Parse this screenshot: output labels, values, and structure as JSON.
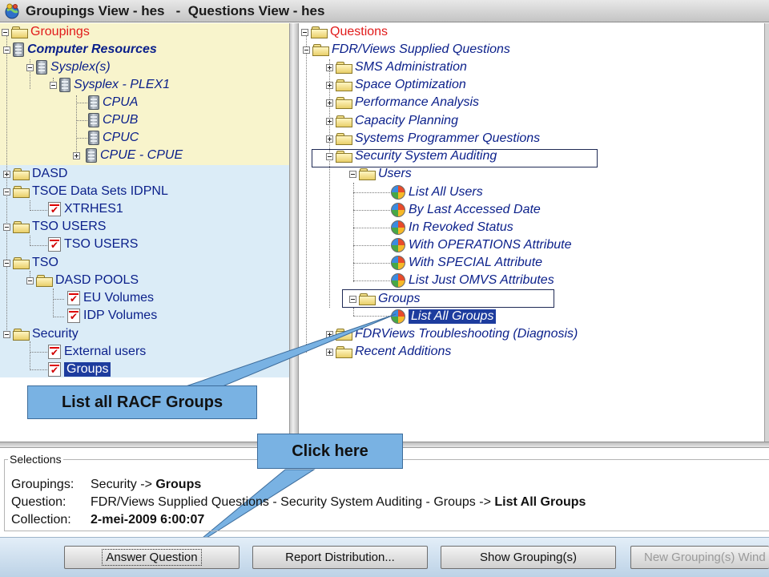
{
  "window": {
    "title": "Groupings View - hes   -  Questions View - hes"
  },
  "groupings_tree": {
    "root": "Groupings",
    "computer_resources": "Computer Resources",
    "sysplexes": "Sysplex(s)",
    "sysplex_plex1": "Sysplex - PLEX1",
    "cpus": [
      "CPUA",
      "CPUB",
      "CPUC",
      "CPUE - CPUE"
    ],
    "dasd": "DASD",
    "tsoe_data_sets": "TSOE Data Sets IDPNL",
    "xtrhes1": "XTRHES1",
    "tso_users_group": "TSO USERS",
    "tso_users_item": "TSO USERS",
    "tso": "TSO",
    "dasd_pools": "DASD POOLS",
    "eu_volumes": "EU Volumes",
    "idp_volumes": "IDP Volumes",
    "security": "Security",
    "external_users": "External users",
    "groups": "Groups"
  },
  "questions_tree": {
    "root": "Questions",
    "supplied": "FDR/Views Supplied Questions",
    "categories": [
      "SMS Administration",
      "Space Optimization",
      "Performance Analysis",
      "Capacity Planning",
      "Systems Programmer Questions"
    ],
    "security_auditing": "Security System Auditing",
    "users": "Users",
    "user_questions": [
      "List All Users",
      "By Last Accessed Date",
      "In Revoked Status",
      "With OPERATIONS Attribute",
      "With SPECIAL Attribute",
      "List Just OMVS Attributes"
    ],
    "groups": "Groups",
    "list_all_groups": "List All Groups",
    "troubleshooting": "FDRViews Troubleshooting (Diagnosis)",
    "recent_additions": "Recent Additions"
  },
  "callouts": {
    "list_all_racf_groups": "List all RACF Groups",
    "click_here": "Click here"
  },
  "selections": {
    "legend": "Selections",
    "groupings_label": "Groupings:",
    "groupings_path": "Security -> ",
    "groupings_value": "Groups",
    "question_label": "Question:",
    "question_path": "FDR/Views Supplied Questions - Security System Auditing - Groups -> ",
    "question_value": "List All Groups",
    "collection_label": "Collection:",
    "collection_value": "2-mei-2009 6:00:07"
  },
  "buttons": {
    "answer_question": "Answer Question",
    "report_distribution": "Report Distribution...",
    "show_groupings": "Show Grouping(s)",
    "new_groupings": "New Grouping(s) Wind"
  }
}
